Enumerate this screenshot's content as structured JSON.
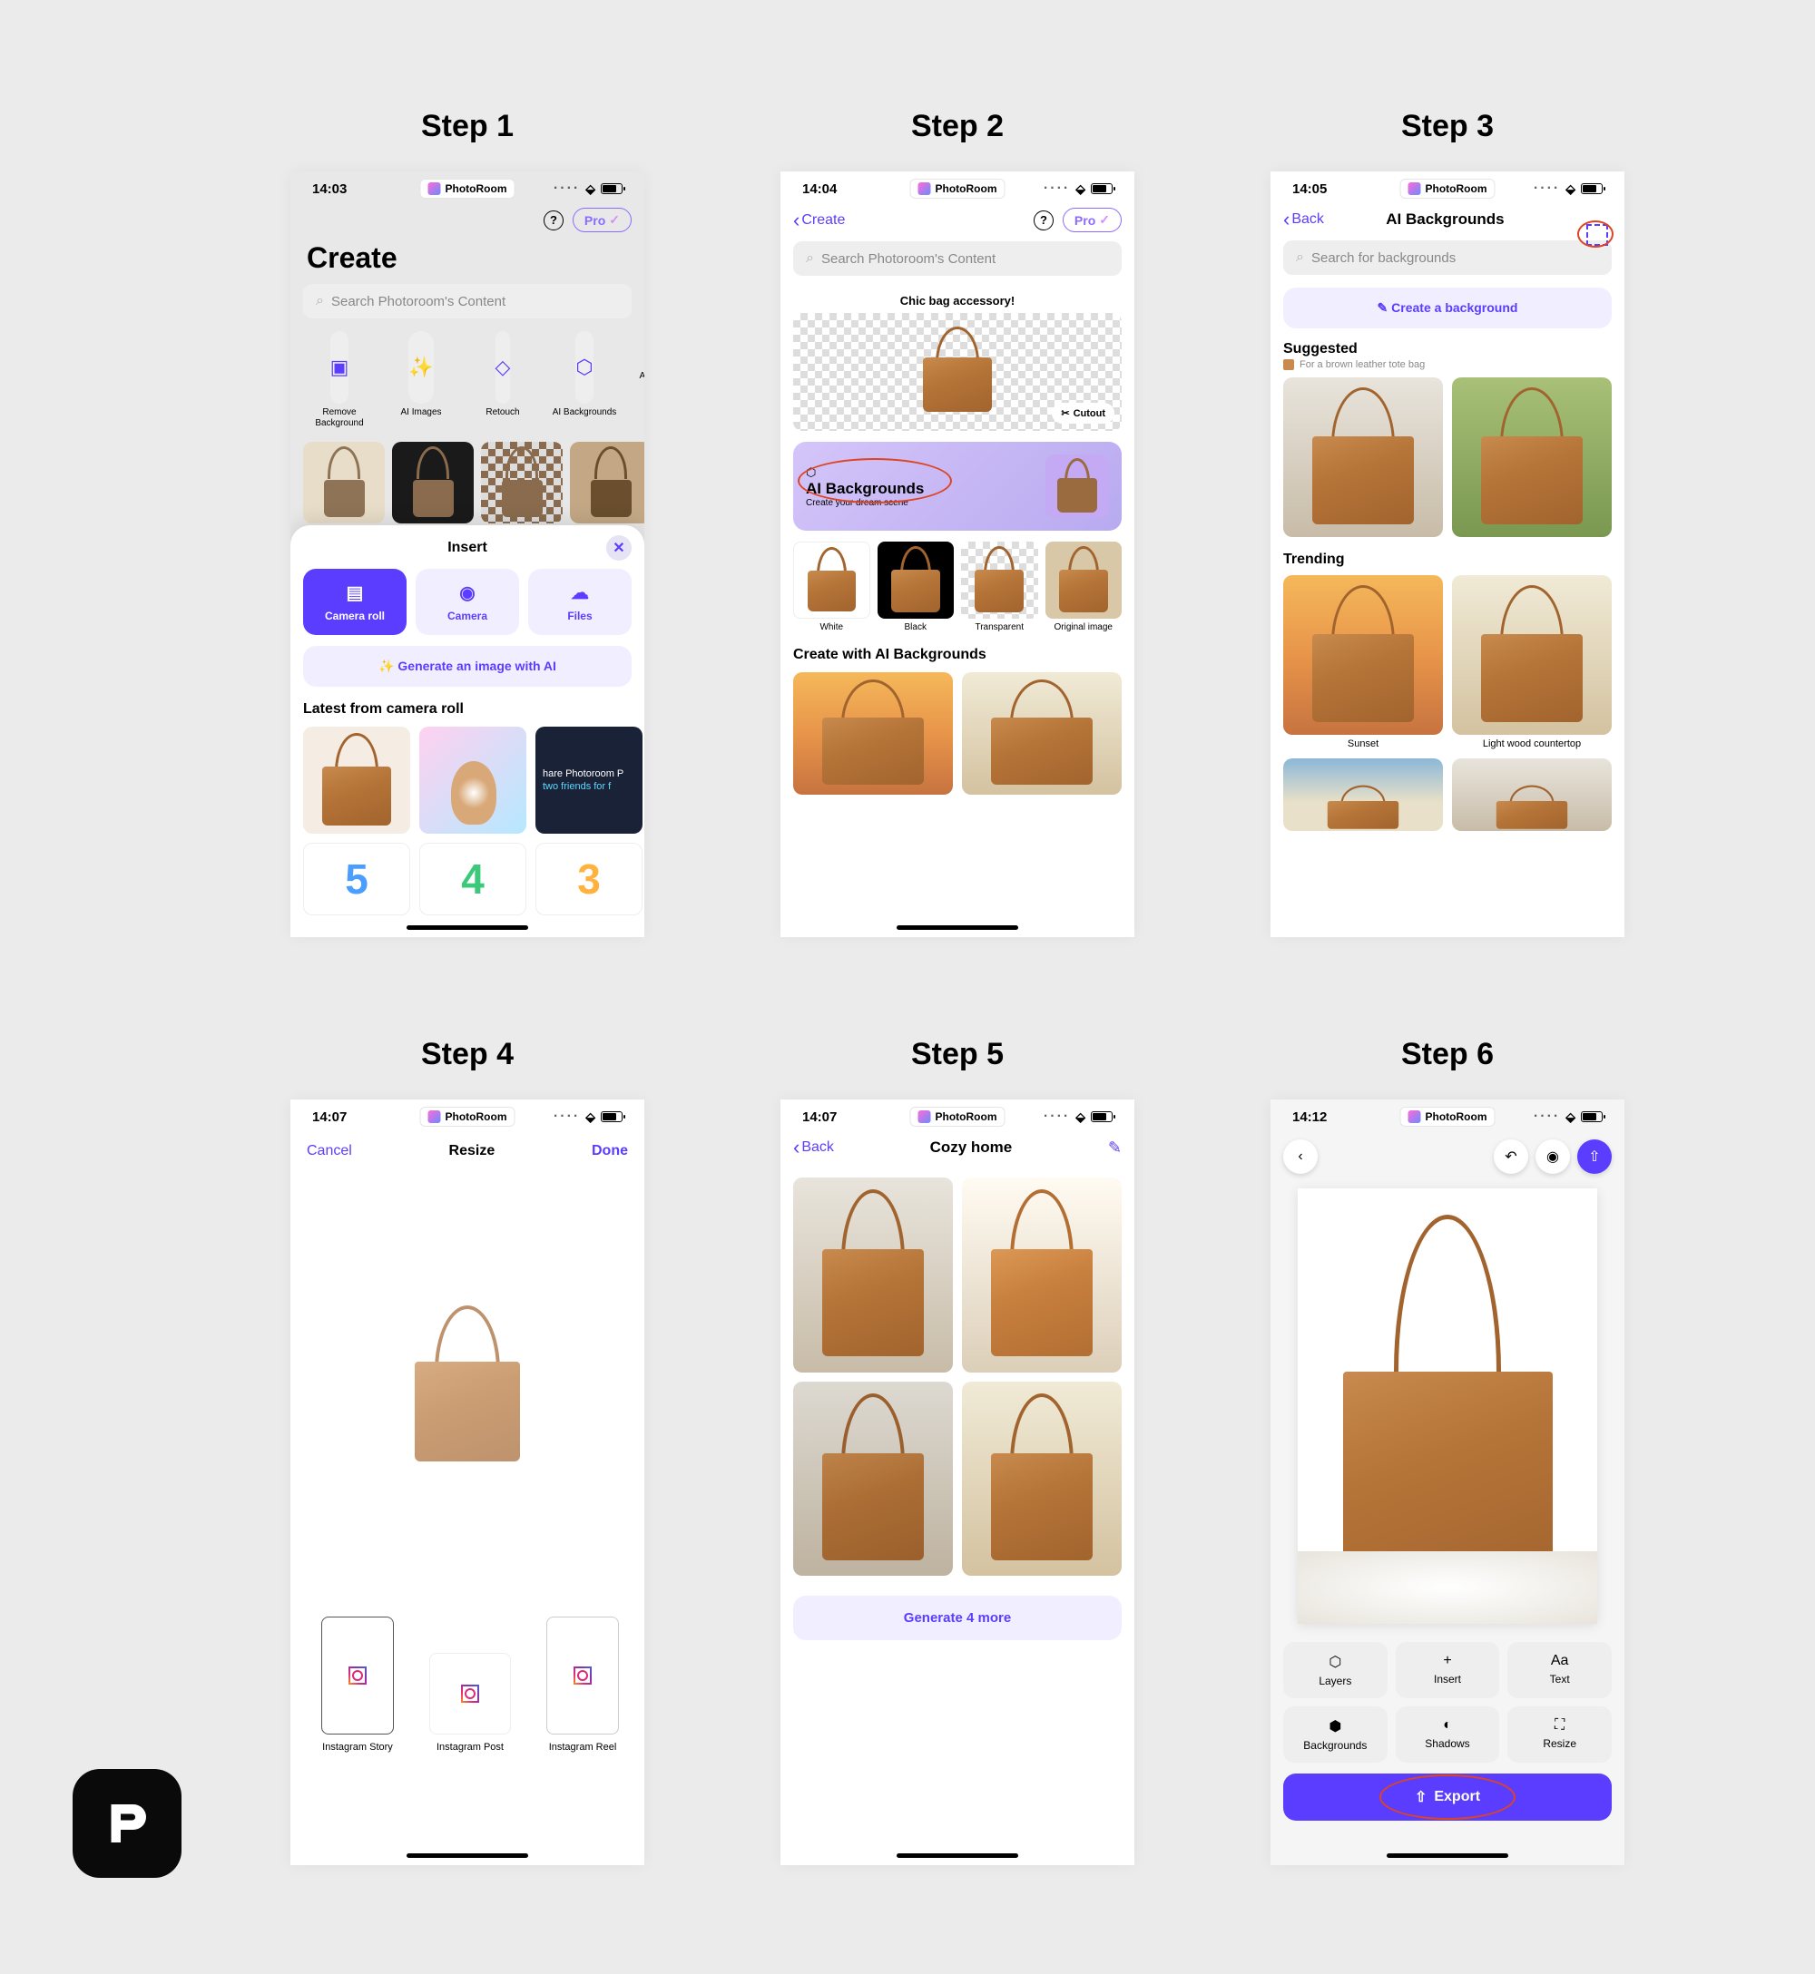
{
  "steps": [
    "Step 1",
    "Step 2",
    "Step 3",
    "Step 4",
    "Step 5",
    "Step 6"
  ],
  "brand": "PhotoRoom",
  "pro_label": "Pro",
  "s1": {
    "time": "14:03",
    "title": "Create",
    "search_placeholder": "Search Photoroom's Content",
    "tools": [
      "Remove Background",
      "AI Images",
      "Retouch",
      "AI Backgrounds",
      "AI S"
    ],
    "sheet_title": "Insert",
    "sources": [
      "Camera roll",
      "Camera",
      "Files"
    ],
    "gen_ai": "Generate an image with AI",
    "latest_h": "Latest from camera roll",
    "promo1": "hare Photoroom P",
    "promo2": "two friends for f"
  },
  "s2": {
    "time": "14:04",
    "back": "Create",
    "search_placeholder": "Search Photoroom's Content",
    "callout": "Chic bag accessory!",
    "cutout": "Cutout",
    "ai_title": "AI Backgrounds",
    "ai_sub": "Create your dream scene",
    "variants": [
      "White",
      "Black",
      "Transparent",
      "Original image"
    ],
    "section_h": "Create with AI Backgrounds"
  },
  "s3": {
    "time": "14:05",
    "back": "Back",
    "title": "AI Backgrounds",
    "search_placeholder": "Search for backgrounds",
    "create_btn": "Create a background",
    "suggested_h": "Suggested",
    "hint": "For a brown leather tote bag",
    "trending_h": "Trending",
    "tiles": [
      "Sunset",
      "Light wood countertop"
    ]
  },
  "s4": {
    "time": "14:07",
    "cancel": "Cancel",
    "title": "Resize",
    "done": "Done",
    "presets": [
      "Instagram Story",
      "Instagram Post",
      "Instagram Reel"
    ]
  },
  "s5": {
    "time": "14:07",
    "back": "Back",
    "title": "Cozy home",
    "gen_more": "Generate 4 more"
  },
  "s6": {
    "time": "14:12",
    "toolbar": [
      "Layers",
      "Insert",
      "Text",
      "Backgrounds",
      "Shadows",
      "Resize"
    ],
    "text_prefix": "Aa",
    "export": "Export"
  }
}
